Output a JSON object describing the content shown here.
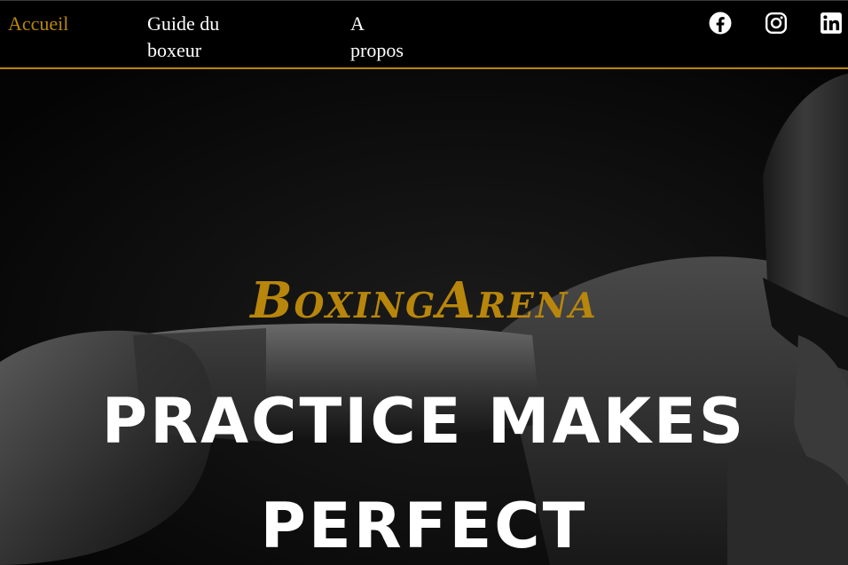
{
  "navbar": {
    "links": [
      {
        "label": "Accueil",
        "active": true
      },
      {
        "label": "Guide du boxeur",
        "active": false
      },
      {
        "label": "A propos",
        "active": false
      }
    ],
    "social": [
      {
        "icon": "facebook-icon"
      },
      {
        "icon": "instagram-icon"
      },
      {
        "icon": "linkedin-icon"
      }
    ],
    "accent_color": "#b8860b"
  },
  "hero": {
    "brand": "BoxingArena",
    "slogan": "PRACTICE MAKES PERFECT",
    "brand_color": "#b8860b",
    "slogan_color": "#ffffff"
  }
}
